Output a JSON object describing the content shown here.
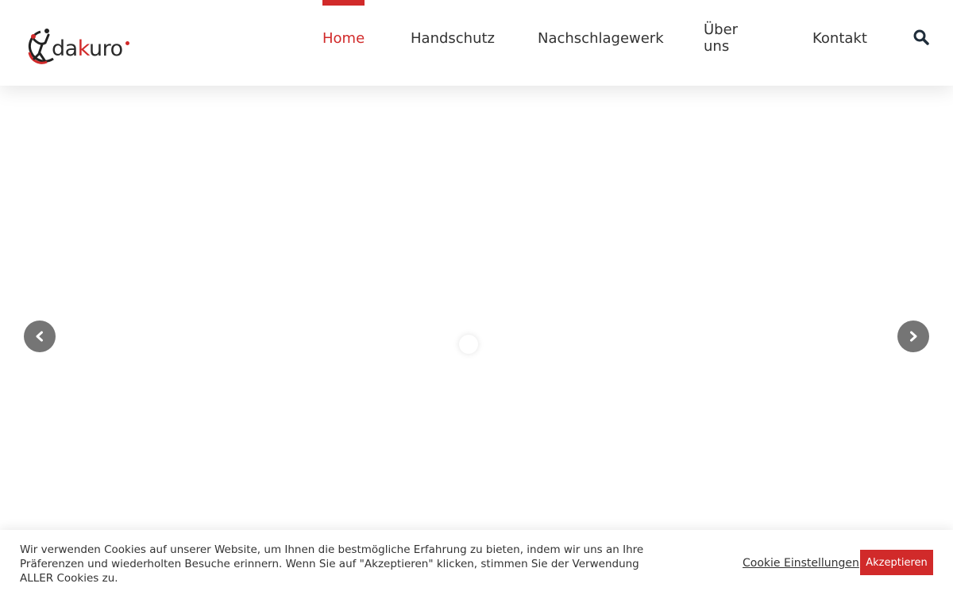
{
  "brand": {
    "name_prefix": "da",
    "name_accent": "k",
    "name_suffix": "uro",
    "accent_color": "#d12a2a"
  },
  "nav": {
    "items": [
      {
        "label": "Home",
        "active": true
      },
      {
        "label": "Handschutz",
        "active": false
      },
      {
        "label": "Nachschlagewerk",
        "active": false
      },
      {
        "label": "Über uns",
        "active": false
      },
      {
        "label": "Kontakt",
        "active": false
      }
    ],
    "search_icon": "search-icon"
  },
  "slider": {
    "prev_icon": "chevron-left-icon",
    "next_icon": "chevron-right-icon"
  },
  "cookie_banner": {
    "text": "Wir verwenden Cookies auf unserer Website, um Ihnen die bestmögliche Erfahrung zu bieten, indem wir uns an Ihre Präferenzen und wiederholten Besuche erinnern. Wenn Sie auf \"Akzeptieren\" klicken, stimmen Sie der Verwendung ALLER Cookies zu.",
    "settings_label": "Cookie Einstellungen",
    "accept_label": "Akzeptieren"
  }
}
